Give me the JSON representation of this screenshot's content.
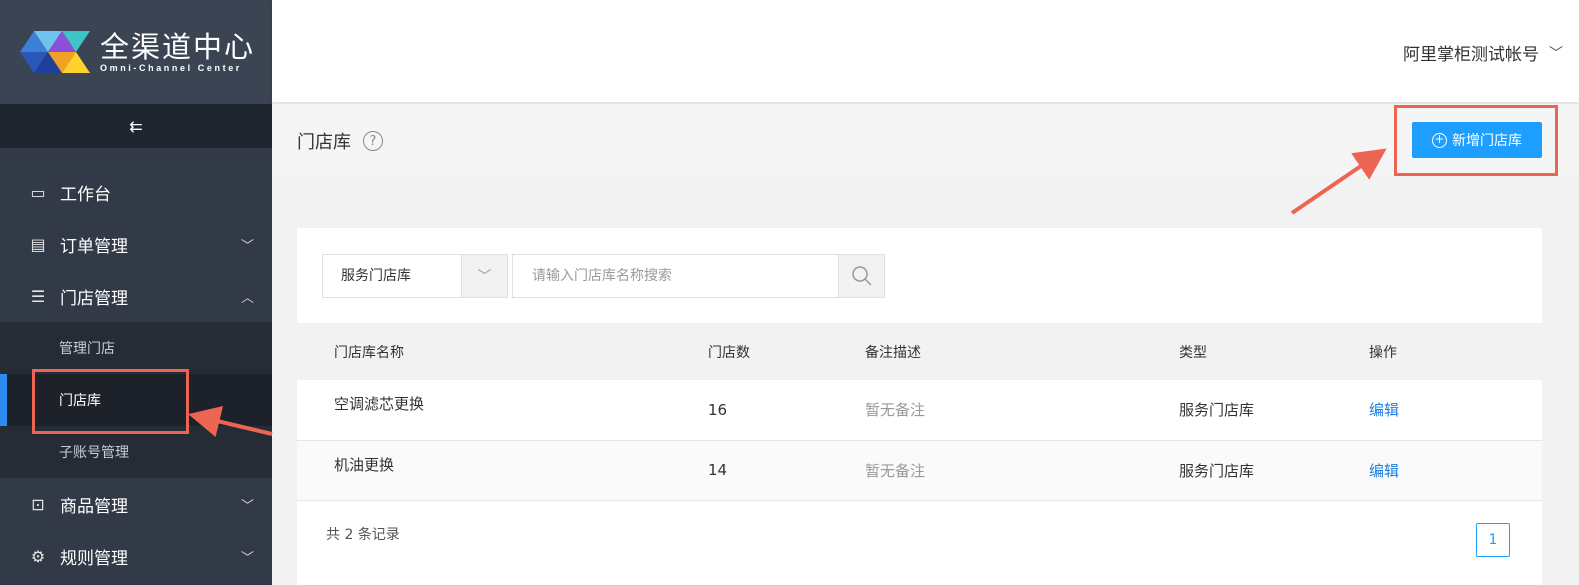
{
  "app": {
    "title": "全渠道中心",
    "subtitle": "Omni-Channel Center"
  },
  "sidebar": {
    "collapse_icon": "menu-collapse-icon",
    "items": [
      {
        "label": "工作台",
        "icon": "monitor-icon"
      },
      {
        "label": "订单管理",
        "icon": "document-icon"
      },
      {
        "label": "门店管理",
        "icon": "list-icon"
      },
      {
        "label": "商品管理",
        "icon": "bag-icon"
      },
      {
        "label": "规则管理",
        "icon": "gear-icon"
      }
    ],
    "subitems": [
      {
        "label": "管理门店"
      },
      {
        "label": "门店库"
      },
      {
        "label": "子账号管理"
      }
    ]
  },
  "header": {
    "account": "阿里掌柜测试帐号"
  },
  "page": {
    "title": "门店库",
    "help": "?",
    "add_button": "新增门店库"
  },
  "filters": {
    "type_value": "服务门店库",
    "search_placeholder": "请输入门店库名称搜索"
  },
  "table": {
    "headers": [
      "门店库名称",
      "门店数",
      "备注描述",
      "类型",
      "操作"
    ],
    "rows": [
      {
        "name": "空调滤芯更换",
        "count": "16",
        "note": "暂无备注",
        "type": "服务门店库",
        "action": "编辑"
      },
      {
        "name": "机油更换",
        "count": "14",
        "note": "暂无备注",
        "type": "服务门店库",
        "action": "编辑"
      }
    ]
  },
  "footer": {
    "total": "共 2 条记录",
    "page": "1"
  },
  "colors": {
    "accent": "#1e9fff",
    "sidebar": "#313a46",
    "annotation": "#ec6452"
  }
}
